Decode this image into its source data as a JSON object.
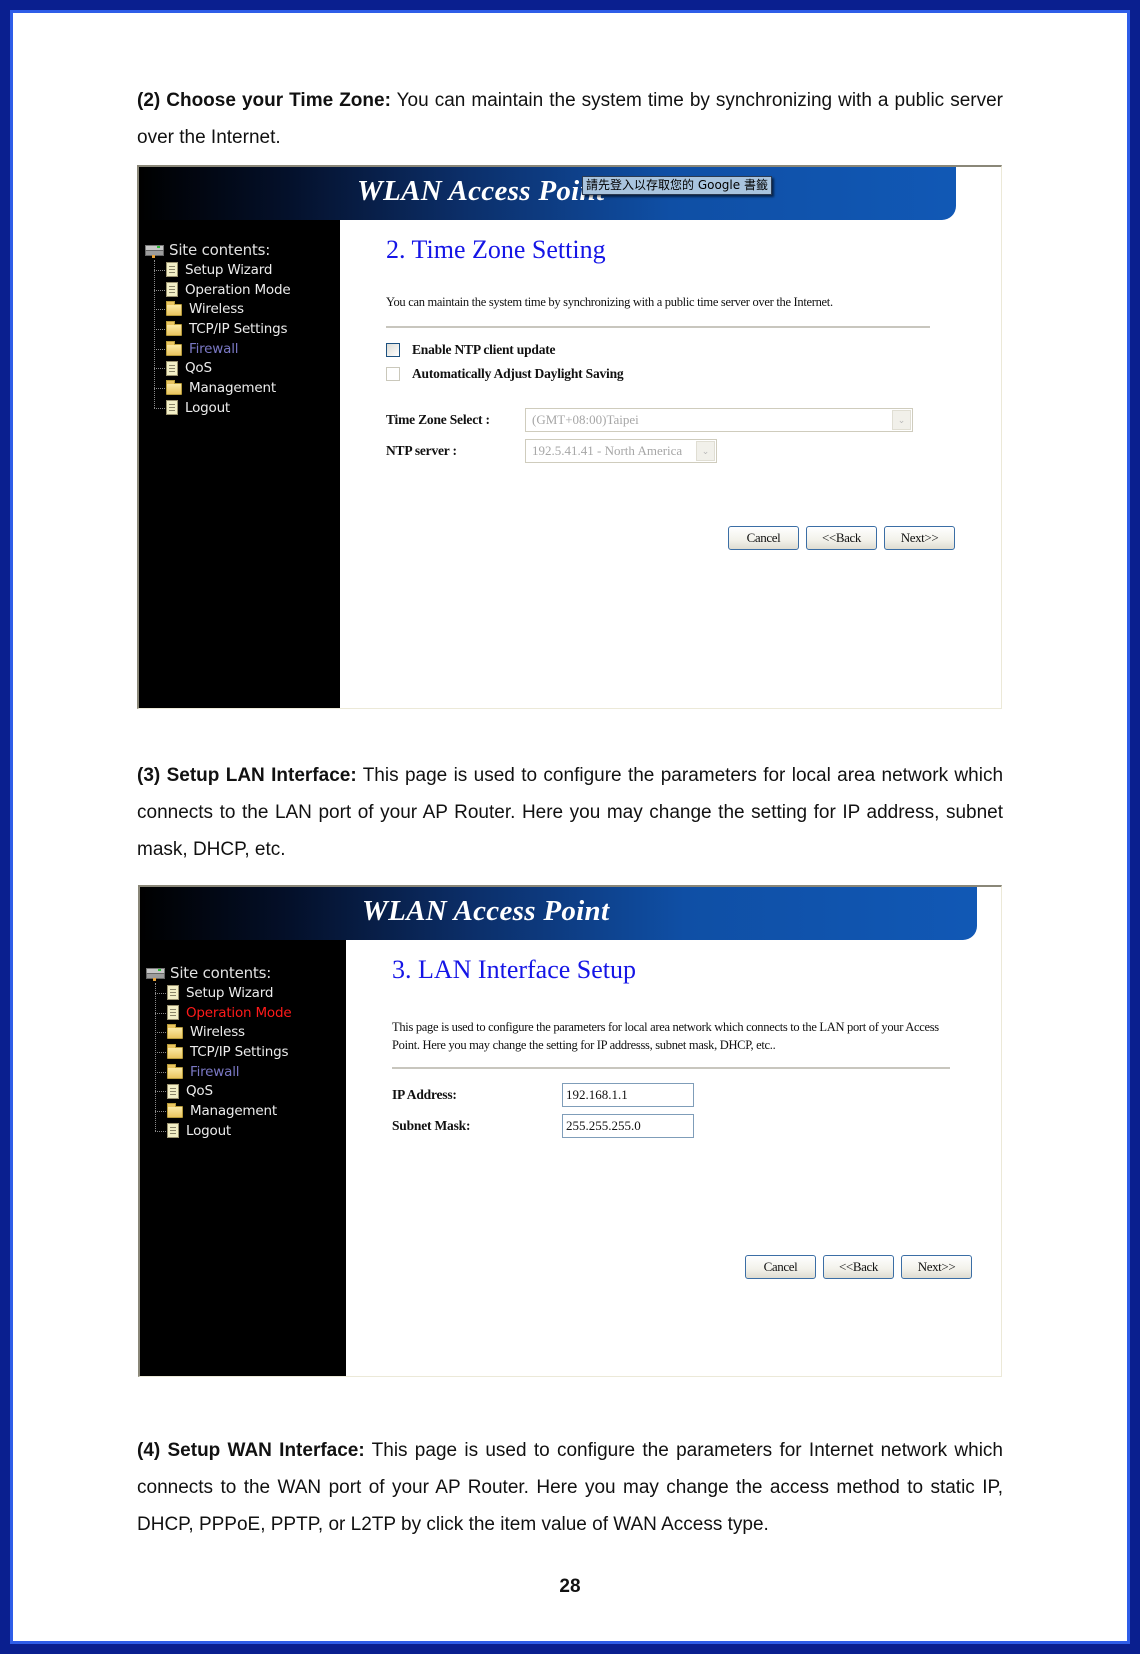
{
  "sections": [
    {
      "heading": "(2) Choose your Time Zone:",
      "body": "You can maintain the system time by synchronizing with a public server over the Internet."
    },
    {
      "heading": "(3) Setup LAN Interface:",
      "body": "This page is used to configure the parameters for local area network which connects to the LAN port of your AP Router. Here you may change the setting for IP address, subnet mask, DHCP, etc."
    },
    {
      "heading": "(4) Setup WAN Interface:",
      "body": "This page is used to configure the parameters for Internet network which connects to the WAN port of your AP Router. Here you may change the access method to static IP, DHCP, PPPoE, PPTP, or L2TP by click the item value of WAN Access type."
    }
  ],
  "shot1": {
    "banner_title": "WLAN Access Point",
    "tooltip": "請先登入以存取您的 Google 書籤",
    "tree_root": "Site contents:",
    "tree": [
      {
        "label": "Setup Wizard",
        "icon": "document-icon"
      },
      {
        "label": "Operation Mode",
        "icon": "document-icon"
      },
      {
        "label": "Wireless",
        "icon": "folder-icon"
      },
      {
        "label": "TCP/IP Settings",
        "icon": "folder-icon"
      },
      {
        "label": "Firewall",
        "icon": "folder-icon"
      },
      {
        "label": "QoS",
        "icon": "document-icon"
      },
      {
        "label": "Management",
        "icon": "folder-icon"
      },
      {
        "label": "Logout",
        "icon": "document-icon"
      }
    ],
    "title": "2. Time Zone Setting",
    "description": "You can maintain the system time by synchronizing with a public time server over the Internet.",
    "checkbox_ntp": "Enable NTP client update",
    "checkbox_dst": "Automatically Adjust Daylight Saving",
    "tz_label": "Time Zone Select :",
    "tz_value": "(GMT+08:00)Taipei",
    "ntp_label": "NTP server :",
    "ntp_value": "192.5.41.41 - North America",
    "buttons": {
      "cancel": "Cancel",
      "back": "<<Back",
      "next": "Next>>"
    }
  },
  "shot2": {
    "banner_title": "WLAN Access Point",
    "tree_root": "Site contents:",
    "tree": [
      {
        "label": "Setup Wizard",
        "icon": "document-icon"
      },
      {
        "label": "Operation Mode",
        "icon": "document-icon"
      },
      {
        "label": "Wireless",
        "icon": "folder-icon"
      },
      {
        "label": "TCP/IP Settings",
        "icon": "folder-icon"
      },
      {
        "label": "Firewall",
        "icon": "folder-icon"
      },
      {
        "label": "QoS",
        "icon": "document-icon"
      },
      {
        "label": "Management",
        "icon": "folder-icon"
      },
      {
        "label": "Logout",
        "icon": "document-icon"
      }
    ],
    "title": "3. LAN Interface Setup",
    "description": "This page is used to configure the parameters for local area network which connects to the LAN port of your Access Point. Here you may change the setting for IP addresss, subnet mask, DHCP, etc..",
    "ip_label": "IP Address:",
    "ip_value": "192.168.1.1",
    "mask_label": "Subnet Mask:",
    "mask_value": "255.255.255.0",
    "buttons": {
      "cancel": "Cancel",
      "back": "<<Back",
      "next": "Next>>"
    }
  },
  "page_number": "28"
}
